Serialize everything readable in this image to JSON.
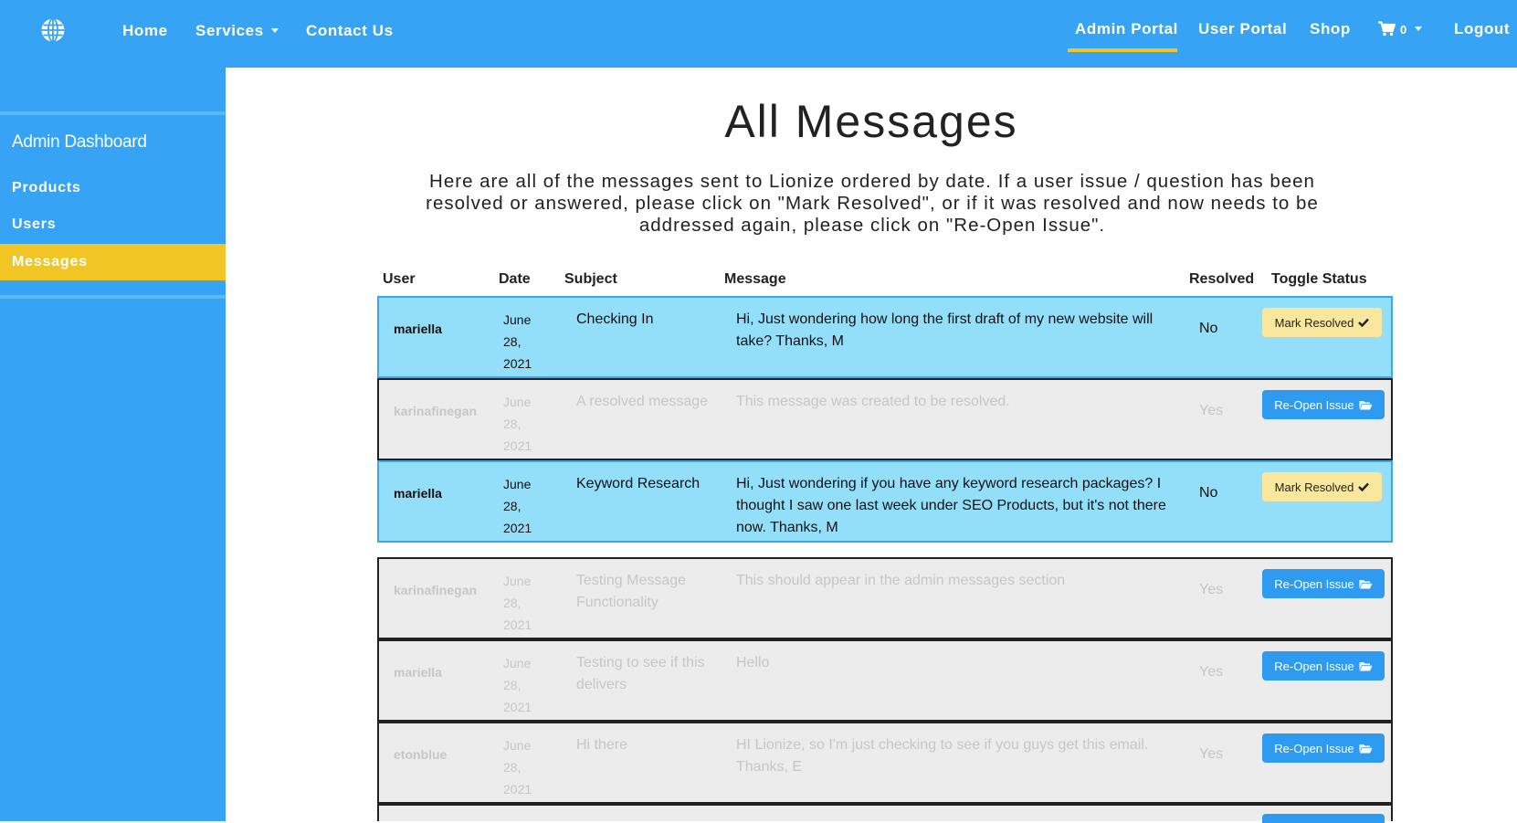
{
  "navbar": {
    "links": {
      "home": "Home",
      "services": "Services",
      "contact": "Contact Us"
    },
    "right": {
      "admin": "Admin Portal",
      "user": "User Portal",
      "shop": "Shop",
      "cart_count": "0",
      "logout": "Logout"
    },
    "colors": {
      "bar": "#36a3f4",
      "accent": "#f0c524"
    }
  },
  "sidebar": {
    "title": "Admin Dashboard",
    "items": [
      {
        "label": "Products"
      },
      {
        "label": "Users"
      },
      {
        "label": "Messages"
      }
    ]
  },
  "main": {
    "title": "All Messages",
    "intro": "Here are all of the messages sent to Lionize ordered by date. If a user issue / question has been resolved or answered, please click on \"Mark Resolved\", or if it was resolved and now needs to be addressed again, please click on \"Re-Open Issue\"."
  },
  "table": {
    "headers": [
      "User",
      "Date",
      "Subject",
      "Message",
      "Resolved",
      "Toggle Status"
    ],
    "rows": [
      {
        "user": "mariella",
        "date": "June 28, 2021",
        "subject": "Checking In",
        "message": "Hi, Just wondering how long the first draft of my new website will take? Thanks, M",
        "resolved": "No",
        "action": "Mark Resolved"
      },
      {
        "user": "karinafinegan",
        "date": "June 28, 2021",
        "subject": "A resolved message",
        "message": "This message was created to be resolved.",
        "resolved": "Yes",
        "action": "Re-Open Issue"
      },
      {
        "user": "mariella",
        "date": "June 28, 2021",
        "subject": "Keyword Research",
        "message": "Hi, Just wondering if you have any keyword research packages? I thought I saw one last week under SEO Products, but it's not there now. Thanks, M",
        "resolved": "No",
        "action": "Mark Resolved"
      },
      {
        "user": "karinafinegan",
        "date": "June 28, 2021",
        "subject": "Testing Message Functionality",
        "message": "This should appear in the admin messages section",
        "resolved": "Yes",
        "action": "Re-Open Issue"
      },
      {
        "user": "mariella",
        "date": "June 28, 2021",
        "subject": "Testing to see if this delivers",
        "message": "Hello",
        "resolved": "Yes",
        "action": "Re-Open Issue"
      },
      {
        "user": "etonblue",
        "date": "June 28, 2021",
        "subject": "Hi there",
        "message": "HI Lionize, so I'm just checking to see if you guys get this email. Thanks, E",
        "resolved": "Yes",
        "action": "Re-Open Issue"
      }
    ]
  }
}
